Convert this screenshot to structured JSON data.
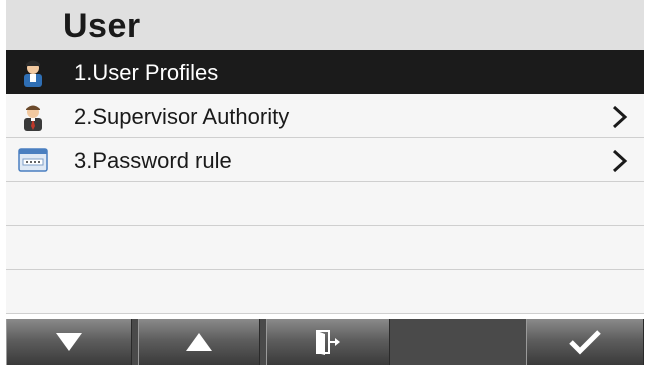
{
  "header": {
    "title": "User"
  },
  "menu": {
    "items": [
      {
        "label": "1.User Profiles",
        "icon": "user-profile-icon",
        "selected": true,
        "has_submenu": false
      },
      {
        "label": "2.Supervisor Authority",
        "icon": "supervisor-icon",
        "selected": false,
        "has_submenu": true
      },
      {
        "label": "3.Password rule",
        "icon": "password-icon",
        "selected": false,
        "has_submenu": true
      }
    ]
  },
  "toolbar": {
    "buttons": [
      "down-arrow-icon",
      "up-arrow-icon",
      "exit-icon",
      "checkmark-icon"
    ]
  },
  "colors": {
    "header_bg": "#e0e0e0",
    "selected_row": "#1b1b1b",
    "row_bg": "#f6f6f6",
    "toolbar": "#4a4a4a"
  }
}
